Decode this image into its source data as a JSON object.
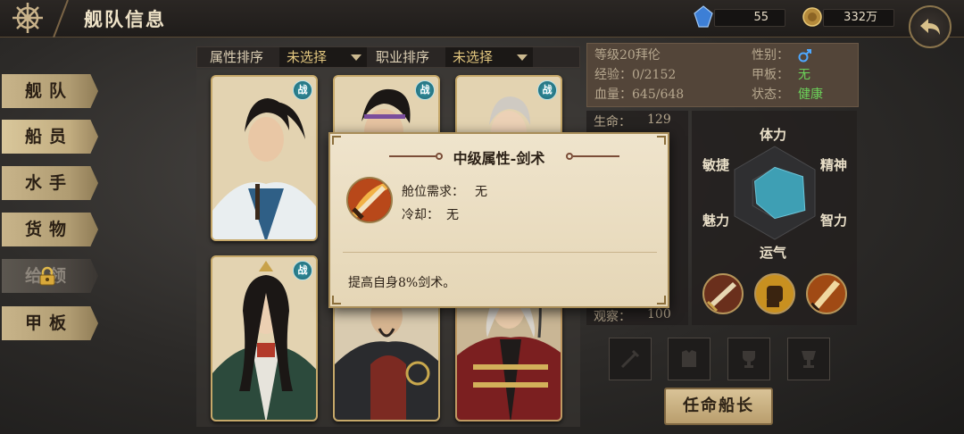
{
  "header": {
    "title": "舰队信息",
    "gems": "55",
    "coins": "332万"
  },
  "nav": {
    "items": [
      {
        "label": "舰队"
      },
      {
        "label": "船员"
      },
      {
        "label": "水手"
      },
      {
        "label": "货物"
      },
      {
        "label": "给领"
      },
      {
        "label": "甲板"
      }
    ]
  },
  "filters": {
    "attr_label": "属性排序",
    "attr_value": "未选择",
    "job_label": "职业排序",
    "job_value": "未选择"
  },
  "crew_cards": [
    {
      "badge": "战"
    },
    {
      "badge": "战"
    },
    {
      "badge": "战"
    },
    {
      "badge": "战"
    }
  ],
  "character": {
    "level_name": "等级20拜伦",
    "gender_label": "性别：",
    "gender_icon": "male-icon",
    "exp": "经验：0/2152",
    "deck_label": "甲板：",
    "deck_value": "无",
    "hp": "血量：645/648",
    "status_label": "状态：",
    "status_value": "健康"
  },
  "stats": {
    "life_label": "生命：",
    "life_value": "129",
    "observe_label": "观察：",
    "observe_value": "100"
  },
  "radar": {
    "labels": [
      "体力",
      "精神",
      "智力",
      "运气",
      "魅力",
      "敏捷"
    ],
    "values": [
      0.55,
      0.7,
      0.75,
      0.55,
      0.45,
      0.5
    ],
    "fill_color": "#3e9fb4"
  },
  "skills": [
    {
      "name": "sword-skill-icon"
    },
    {
      "name": "fist-skill-icon"
    },
    {
      "name": "blade-skill-icon"
    }
  ],
  "appoint_button": "任命船长",
  "tooltip": {
    "title": "中级属性-剑术",
    "req_label": "舱位需求：",
    "req_value": "无",
    "cd_label": "冷却：",
    "cd_value": "无",
    "desc": "提高自身8%剑术。"
  }
}
